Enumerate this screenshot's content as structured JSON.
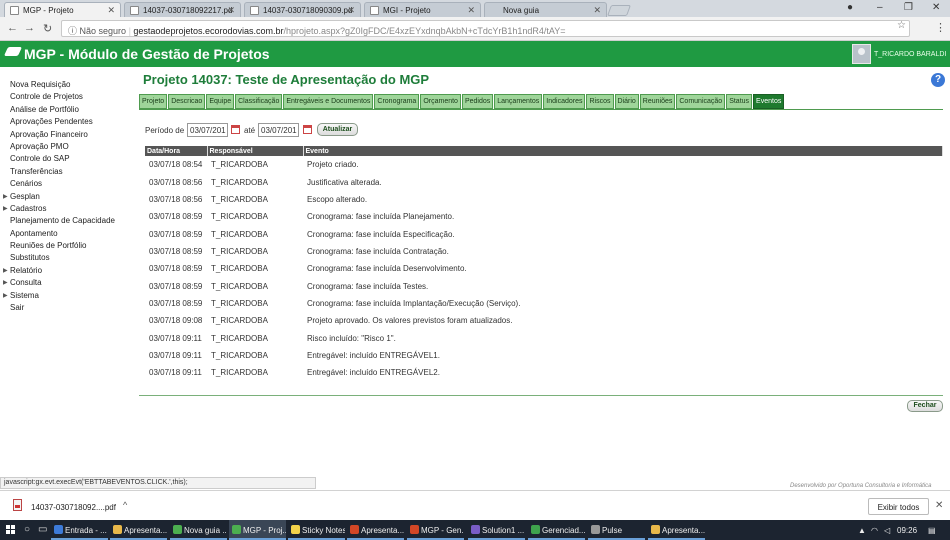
{
  "browser": {
    "tabs": [
      {
        "label": "MGP - Projeto",
        "active": true
      },
      {
        "label": "14037-030718092217.pd",
        "active": false
      },
      {
        "label": "14037-030718090309.pd",
        "active": false
      },
      {
        "label": "MGI - Projeto",
        "active": false
      },
      {
        "label": "Nova guia",
        "active": false
      }
    ],
    "secure_label": "Não seguro",
    "url_host": "gestaodeprojetos.ecorodovias.com.br",
    "url_path": "/hprojeto.aspx?gZ0IgFDC/E4xzEYxdnqbAkbN+cTdcYrB1h1ndR4/tAY="
  },
  "app": {
    "title": "MGP - Módulo de Gestão de Projetos",
    "user": "T_RICARDO BARALDI",
    "brand_color": "#1f9a42"
  },
  "sidebar": {
    "items": [
      {
        "label": "Nova Requisição",
        "expandable": false
      },
      {
        "label": "Controle de Projetos",
        "expandable": false
      },
      {
        "label": "Análise de Portfólio",
        "expandable": false
      },
      {
        "label": "Aprovações Pendentes",
        "expandable": false
      },
      {
        "label": "Aprovação Financeiro",
        "expandable": false
      },
      {
        "label": "Aprovação PMO",
        "expandable": false
      },
      {
        "label": "Controle do SAP",
        "expandable": false
      },
      {
        "label": "Transferências",
        "expandable": false
      },
      {
        "label": "Cenários",
        "expandable": false
      },
      {
        "label": "Gesplan",
        "expandable": true
      },
      {
        "label": "Cadastros",
        "expandable": true
      },
      {
        "label": "Planejamento de Capacidade",
        "expandable": false
      },
      {
        "label": "Apontamento",
        "expandable": false
      },
      {
        "label": "Reuniões de Portfólio",
        "expandable": false
      },
      {
        "label": "Substitutos",
        "expandable": false
      },
      {
        "label": "Relatório",
        "expandable": true
      },
      {
        "label": "Consulta",
        "expandable": true
      },
      {
        "label": "Sistema",
        "expandable": true
      },
      {
        "label": "Sair",
        "expandable": false
      }
    ]
  },
  "project": {
    "title": "Projeto 14037: Teste de Apresentação do MGP",
    "tabs": [
      {
        "label": "Projeto"
      },
      {
        "label": "Descricao"
      },
      {
        "label": "Equipe"
      },
      {
        "label": "Classificação"
      },
      {
        "label": "Entregáveis e Documentos"
      },
      {
        "label": "Cronograma"
      },
      {
        "label": "Orçamento"
      },
      {
        "label": "Pedidos"
      },
      {
        "label": "Lançamentos"
      },
      {
        "label": "Indicadores"
      },
      {
        "label": "Riscos"
      },
      {
        "label": "Diário"
      },
      {
        "label": "Reuniões"
      },
      {
        "label": "Comunicação"
      },
      {
        "label": "Status"
      },
      {
        "label": "Eventos",
        "active": true
      }
    ]
  },
  "filter": {
    "period_label": "Período de",
    "from": "03/07/201",
    "to_label": "até",
    "to": "03/07/201",
    "refresh_label": "Atualizar"
  },
  "events": {
    "columns": [
      "Data/Hora",
      "Responsável",
      "Evento"
    ],
    "rows": [
      [
        "03/07/18 08:54",
        "T_RICARDOBA",
        "Projeto criado."
      ],
      [
        "03/07/18 08:56",
        "T_RICARDOBA",
        "Justificativa alterada."
      ],
      [
        "03/07/18 08:56",
        "T_RICARDOBA",
        "Escopo alterado."
      ],
      [
        "03/07/18 08:59",
        "T_RICARDOBA",
        "Cronograma: fase incluída Planejamento."
      ],
      [
        "03/07/18 08:59",
        "T_RICARDOBA",
        "Cronograma: fase incluída Especificação."
      ],
      [
        "03/07/18 08:59",
        "T_RICARDOBA",
        "Cronograma: fase incluída Contratação."
      ],
      [
        "03/07/18 08:59",
        "T_RICARDOBA",
        "Cronograma: fase incluída Desenvolvimento."
      ],
      [
        "03/07/18 08:59",
        "T_RICARDOBA",
        "Cronograma: fase incluída Testes."
      ],
      [
        "03/07/18 08:59",
        "T_RICARDOBA",
        "Cronograma: fase incluída Implantação/Execução (Serviço)."
      ],
      [
        "03/07/18 09:08",
        "T_RICARDOBA",
        "Projeto aprovado. Os valores previstos foram atualizados."
      ],
      [
        "03/07/18 09:11",
        "T_RICARDOBA",
        "Risco incluído: \"Risco 1\"."
      ],
      [
        "03/07/18 09:11",
        "T_RICARDOBA",
        "Entregável: incluído ENTREGÁVEL1."
      ],
      [
        "03/07/18 09:11",
        "T_RICARDOBA",
        "Entregável: incluído ENTREGÁVEL2."
      ]
    ]
  },
  "close_label": "Fechar",
  "status_text": "javascript:gx.evt.execEvt('EBTTABEVENTOS.CLICK.',this);",
  "credit": "Desenvolvido por Oportuna Consultoria e Informática",
  "downloads": {
    "file": "14037-030718092....pdf",
    "show_all_label": "Exibir todos"
  },
  "taskbar": {
    "items": [
      {
        "label": "Entrada - ...",
        "color": "#3d7bd9"
      },
      {
        "label": "Apresenta...",
        "color": "#e8b84a"
      },
      {
        "label": "Nova guia ...",
        "color": "#4caf50"
      },
      {
        "label": "MGP - Proj...",
        "color": "#4caf50",
        "active": true
      },
      {
        "label": "Sticky Notes",
        "color": "#f3d34a"
      },
      {
        "label": "Apresentа...",
        "color": "#d24726"
      },
      {
        "label": "MGP - Gen...",
        "color": "#d24726"
      },
      {
        "label": "Solution1 ...",
        "color": "#7a5dc7"
      },
      {
        "label": "Gerenciad...",
        "color": "#3fa34d"
      },
      {
        "label": "Pulse",
        "color": "#999999"
      },
      {
        "label": "Apresenta...",
        "color": "#e8b84a"
      }
    ],
    "time": "09:26"
  }
}
